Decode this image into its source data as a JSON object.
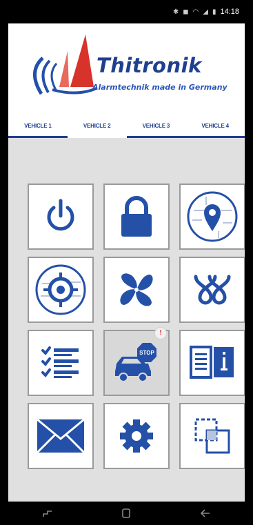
{
  "status_bar": {
    "time": "14:18",
    "icons": [
      "bluetooth-icon",
      "notification-icon",
      "wifi-icon",
      "signal-icon",
      "battery-icon"
    ]
  },
  "header": {
    "brand": "Thitronik",
    "tagline": "Alarmtechnik made in Germany"
  },
  "tabs": [
    {
      "label": "VEHICLE 1",
      "active": true
    },
    {
      "label": "VEHICLE 2",
      "active": false
    },
    {
      "label": "VEHICLE 3",
      "active": false
    },
    {
      "label": "VEHICLE 4",
      "active": false
    }
  ],
  "tiles": [
    {
      "name": "power-icon"
    },
    {
      "name": "lock-icon"
    },
    {
      "name": "location-pin-icon"
    },
    {
      "name": "target-icon"
    },
    {
      "name": "fan-icon"
    },
    {
      "name": "heater-icon"
    },
    {
      "name": "checklist-icon"
    },
    {
      "name": "car-stop-icon",
      "badge": "!",
      "stop_text": "STOP"
    },
    {
      "name": "info-book-icon"
    },
    {
      "name": "mail-icon"
    },
    {
      "name": "settings-gear-icon"
    },
    {
      "name": "copy-windows-icon"
    }
  ],
  "colors": {
    "brand_blue": "#1f3f8f",
    "icon_blue": "#2450a8",
    "logo_red": "#d8332a",
    "tile_border": "#9a9a9a",
    "background": "#e0e0e0"
  },
  "nav_bar": {
    "buttons": [
      "recent-apps-icon",
      "home-icon",
      "back-icon"
    ]
  }
}
